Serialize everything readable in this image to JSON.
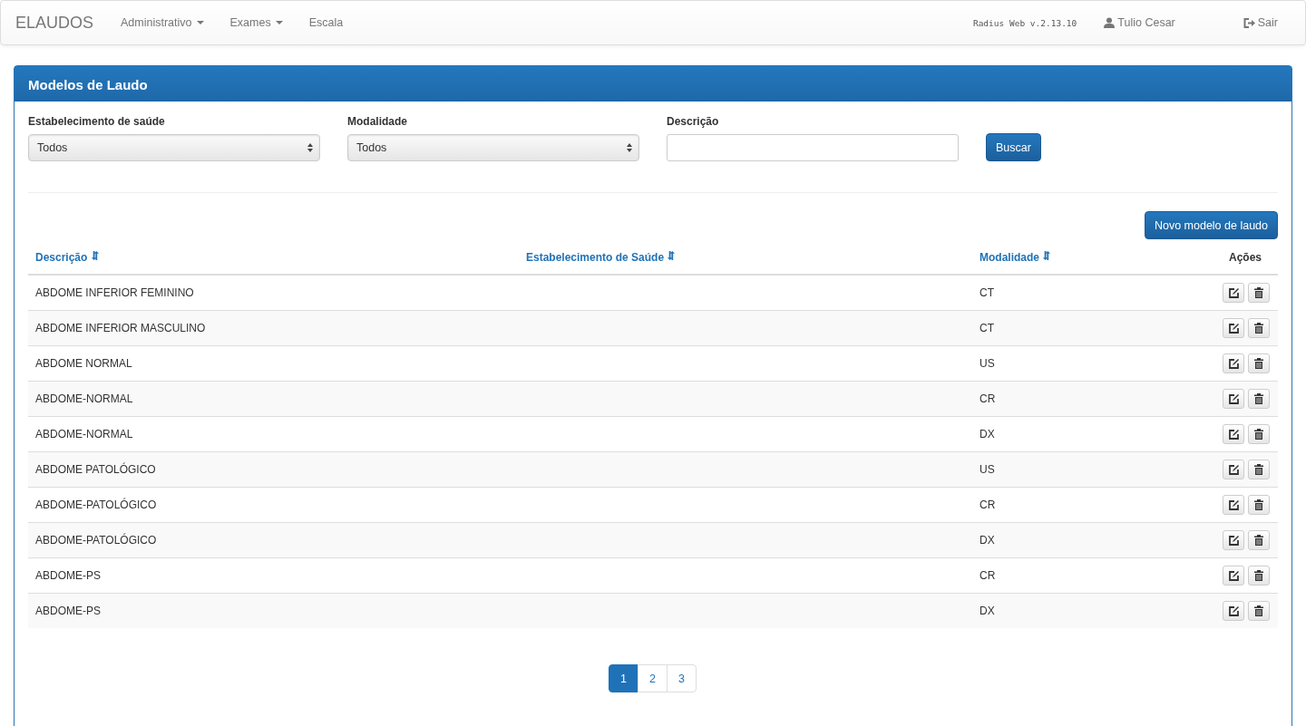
{
  "navbar": {
    "brand": "ELAUDOS",
    "menu": [
      {
        "label": "Administrativo",
        "dropdown": true
      },
      {
        "label": "Exames",
        "dropdown": true
      },
      {
        "label": "Escala",
        "dropdown": false
      }
    ],
    "version": "Radius Web v.2.13.10",
    "user": "Tulio Cesar",
    "logout": "Sair"
  },
  "panel": {
    "title": "Modelos de Laudo",
    "filters": [
      {
        "kind": "select",
        "label": "Estabelecimento de saúde",
        "value": "Todos"
      },
      {
        "kind": "select",
        "label": "Modalidade",
        "value": "Todos"
      },
      {
        "kind": "input",
        "label": "Descrição"
      }
    ],
    "search_button": "Buscar",
    "new_button": "Novo modelo de laudo",
    "table": {
      "columns": [
        {
          "label": "Descrição",
          "sortable": true
        },
        {
          "label": "Estabelecimento de Saúde",
          "sortable": true
        },
        {
          "label": "Modalidade",
          "sortable": true
        },
        {
          "label": "Ações",
          "sortable": false
        }
      ],
      "rows": [
        {
          "descricao": "ABDOME INFERIOR FEMININO",
          "modalidade": "CT"
        },
        {
          "descricao": "ABDOME INFERIOR MASCULINO",
          "modalidade": "CT"
        },
        {
          "descricao": "ABDOME NORMAL",
          "modalidade": "US"
        },
        {
          "descricao": "ABDOME-NORMAL",
          "modalidade": "CR"
        },
        {
          "descricao": "ABDOME-NORMAL",
          "modalidade": "DX"
        },
        {
          "descricao": "ABDOME PATOLÓGICO",
          "modalidade": "US"
        },
        {
          "descricao": "ABDOME-PATOLÓGICO",
          "modalidade": "CR"
        },
        {
          "descricao": "ABDOME-PATOLÓGICO",
          "modalidade": "DX"
        },
        {
          "descricao": "ABDOME-PS",
          "modalidade": "CR"
        },
        {
          "descricao": "ABDOME-PS",
          "modalidade": "DX"
        }
      ]
    },
    "pagination": [
      {
        "label": "1",
        "selected": true
      },
      {
        "label": "2",
        "selected": false
      },
      {
        "label": "3",
        "selected": false
      }
    ]
  }
}
